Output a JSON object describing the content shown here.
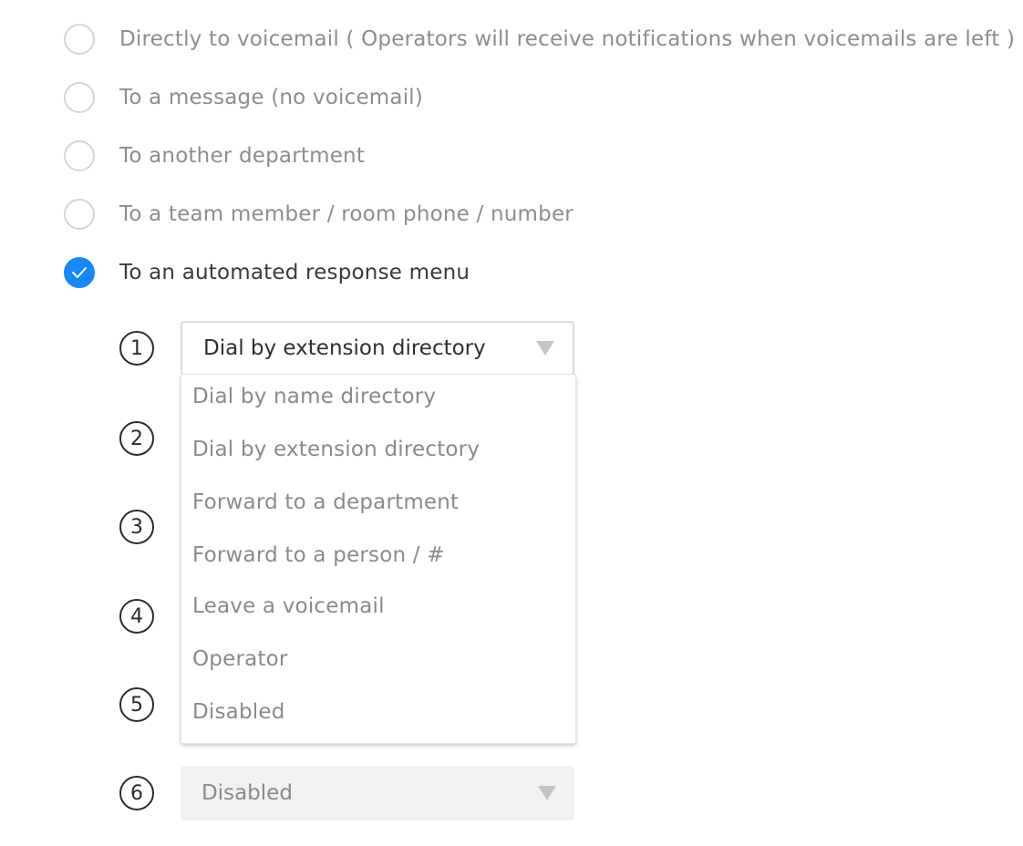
{
  "routing_options": [
    {
      "label": "Directly to voicemail ( Operators will receive notifications when voicemails are left )",
      "checked": false
    },
    {
      "label": "To a message (no voicemail)",
      "checked": false
    },
    {
      "label": "To another department",
      "checked": false
    },
    {
      "label": "To a team member / room phone / number",
      "checked": false
    },
    {
      "label": "To an automated response menu",
      "checked": true
    }
  ],
  "menu_keys": [
    "1",
    "2",
    "3",
    "4",
    "5",
    "6"
  ],
  "key1_select": {
    "value": "Dial by extension directory",
    "icon": "chevron-down-icon"
  },
  "key6_select": {
    "value": "Disabled",
    "icon": "chevron-down-icon"
  },
  "dropdown": {
    "options": [
      "Dial by name directory",
      "Dial by extension directory",
      "Forward to a department",
      "Forward to a person / #",
      "Leave a voicemail",
      "Operator",
      "Disabled"
    ]
  },
  "colors": {
    "accent": "#1589f7",
    "muted_text": "#8d8d8d",
    "dark_text": "#3a3a3a"
  }
}
